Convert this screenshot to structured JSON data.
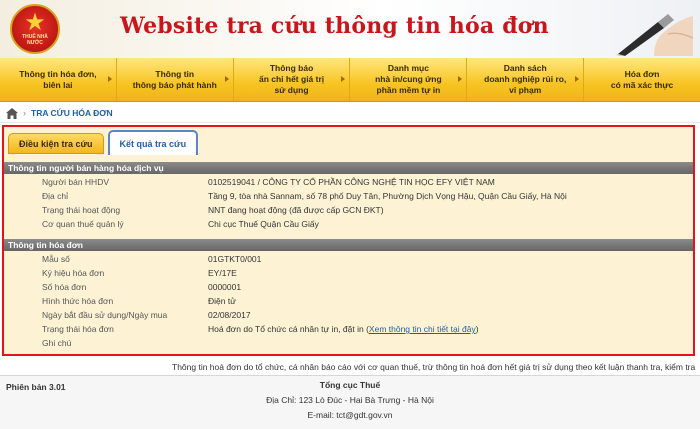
{
  "header": {
    "title": "Website tra cứu thông tin hóa đơn",
    "emblem_caption": "THUẾ NHÀ NƯỚC"
  },
  "nav": {
    "items": [
      {
        "label": "Thông tin hóa đơn,\nbiên lai"
      },
      {
        "label": "Thông tin\nthông báo phát hành"
      },
      {
        "label": "Thông báo\nấn chỉ hết giá trị\nsử dụng"
      },
      {
        "label": "Danh mục\nnhà in/cung ứng\nphần mềm tự in"
      },
      {
        "label": "Danh sách\ndoanh nghiệp rủi ro,\nvi phạm"
      },
      {
        "label": "Hóa đơn\ncó mã xác thực"
      }
    ]
  },
  "breadcrumb": {
    "sep": "›",
    "current": "TRA CỨU HÓA ĐƠN"
  },
  "tabs": {
    "conditions": "Điều kiện tra cứu",
    "results": "Kết quả tra cứu"
  },
  "seller": {
    "heading": "Thông tin người bán hàng hóa dịch vụ",
    "rows": [
      {
        "label": "Người bán HHDV",
        "value": "0102519041 / CÔNG TY CỔ PHẦN CÔNG NGHỆ TIN HỌC EFY VIỆT NAM"
      },
      {
        "label": "Địa chỉ",
        "value": "Tầng 9, tòa nhà Sannam, số 78 phố Duy Tân, Phường Dịch Vọng Hậu, Quận Cầu Giấy, Hà Nội"
      },
      {
        "label": "Trạng thái hoạt động",
        "value": "NNT đang hoạt động (đã được cấp GCN ĐKT)"
      },
      {
        "label": "Cơ quan thuế quản lý",
        "value": "Chi cục Thuế Quận Cầu Giấy"
      }
    ]
  },
  "invoice": {
    "heading": "Thông tin hóa đơn",
    "rows": [
      {
        "label": "Mẫu số",
        "value": "01GTKT0/001"
      },
      {
        "label": "Ký hiệu hóa đơn",
        "value": "EY/17E"
      },
      {
        "label": "Số hóa đơn",
        "value": "0000001"
      },
      {
        "label": "Hình thức hóa đơn",
        "value": "Điện tử"
      },
      {
        "label": "Ngày bắt đầu sử dụng/Ngày mua",
        "value": "02/08/2017"
      },
      {
        "label": "Trạng thái hóa đơn",
        "value": "Hoá đơn do Tổ chức cá nhân tự in, đặt in ("
      },
      {
        "label": "Ghi chú",
        "value": ""
      }
    ],
    "status_link": "Xem thông tin chi tiết tại đây",
    "status_close": ")"
  },
  "notice": "Thông tin hoá đơn do tổ chức, cá nhân báo cáo với cơ quan thuế, trừ thông tin hoá đơn hết giá trị sử dụng theo kết luận thanh tra, kiểm tra",
  "footer": {
    "version": "Phiên bản 3.01",
    "org": "Tổng cục Thuế",
    "address": "Địa Chỉ: 123 Lò Đúc - Hai Bà Trưng - Hà Nội",
    "email": "E-mail: tct@gdt.gov.vn"
  },
  "colors": {
    "brand_red": "#c8161d",
    "nav_gold": "#f7c522",
    "panel_border": "#e3141e",
    "link_blue": "#1f5fa8"
  }
}
